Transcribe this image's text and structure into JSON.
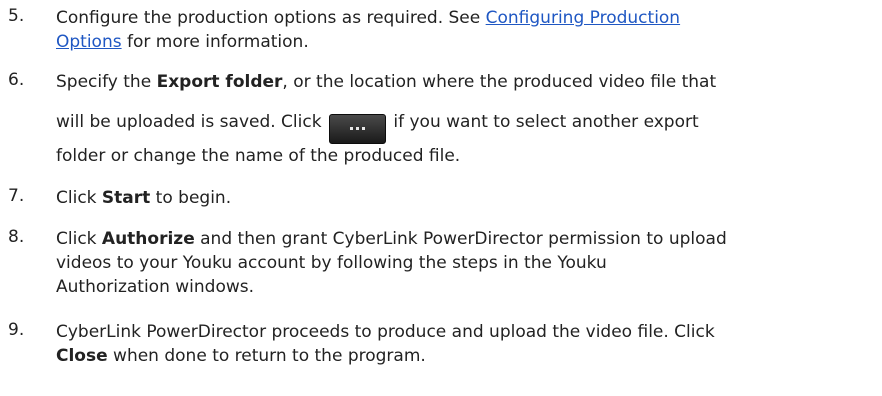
{
  "steps": [
    {
      "number": "5.",
      "line1_prefix": "Configure the production options as required. See ",
      "link_part1": "Configuring Production",
      "link_part2": "Options",
      "line2_suffix": " for more information."
    },
    {
      "number": "6.",
      "line1_prefix": "Specify the ",
      "bold1": "Export folder",
      "line1_suffix": ", or the location where the produced video file that",
      "line2_prefix": "will be uploaded is saved. Click ",
      "button_icon": "ellipsis-browse-icon",
      "line2_suffix": " if you want to select another export",
      "line3": "folder or change the name of the produced file."
    },
    {
      "number": "7.",
      "prefix": "Click ",
      "bold": "Start",
      "suffix": " to begin."
    },
    {
      "number": "8.",
      "line1_prefix": "Click ",
      "bold": "Authorize",
      "line1_suffix": " and then grant CyberLink PowerDirector permission to upload",
      "line2": "videos to your Youku account by following the steps in the Youku",
      "line3": "Authorization windows."
    },
    {
      "number": "9.",
      "line1": "CyberLink PowerDirector proceeds to produce and upload the video file. Click",
      "bold": "Close",
      "line2_suffix": " when done to return to the program."
    }
  ],
  "colors": {
    "text": "#222222",
    "link": "#1f57c3",
    "button_bg": "#2a2a2a"
  }
}
